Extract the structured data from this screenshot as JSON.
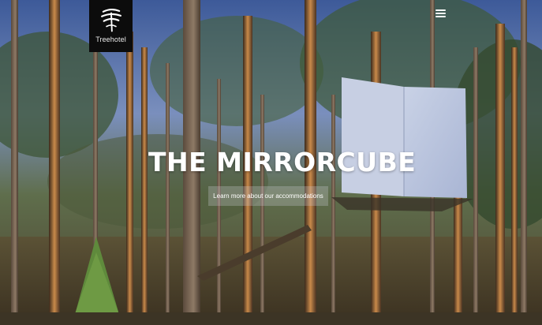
{
  "brand": {
    "name": "Treehotel",
    "logo_icon": "tree-logo-icon"
  },
  "nav": {
    "menu_icon": "hamburger-menu-icon"
  },
  "hero": {
    "title": "THE MIRRORCUBE",
    "cta_label": "Learn more about our accommodations"
  },
  "colors": {
    "logo_bg": "#0c0c0c",
    "text": "#ffffff",
    "sky": "#4a67a6"
  }
}
